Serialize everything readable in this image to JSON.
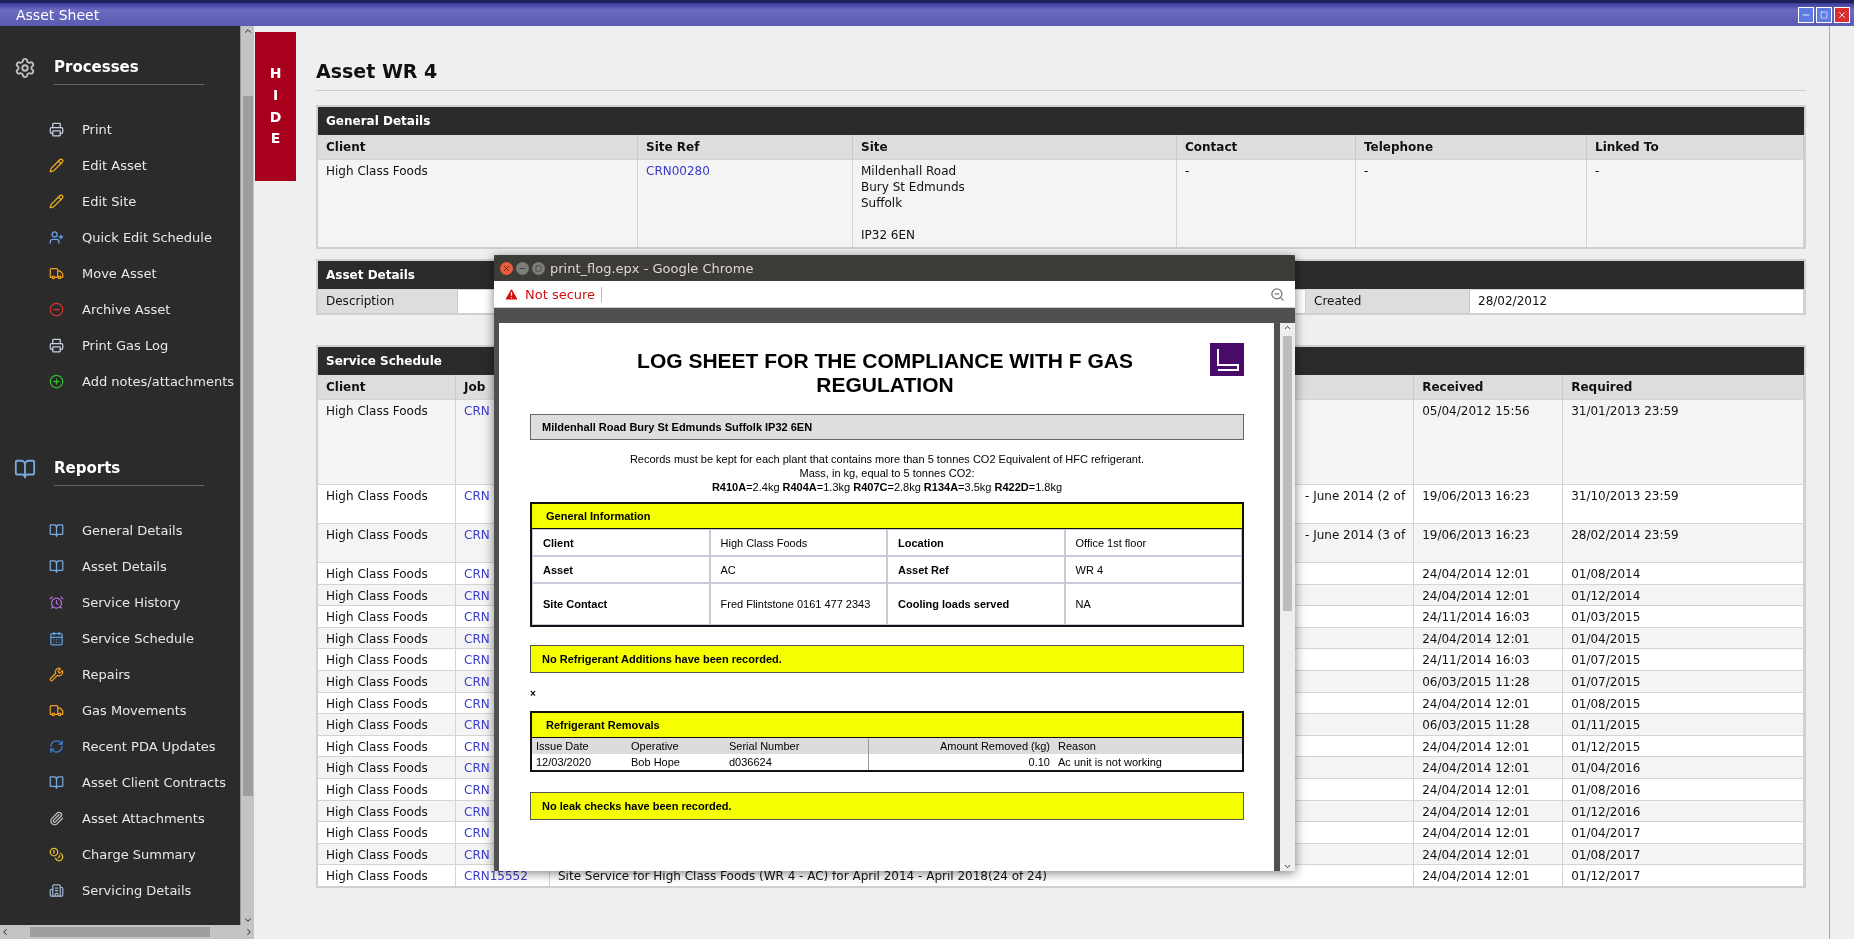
{
  "window": {
    "title": "Asset Sheet"
  },
  "sidebar": {
    "sections": [
      {
        "title": "Processes",
        "items": [
          {
            "label": "Print"
          },
          {
            "label": "Edit Asset"
          },
          {
            "label": "Edit Site"
          },
          {
            "label": "Quick Edit Schedule"
          },
          {
            "label": "Move Asset"
          },
          {
            "label": "Archive Asset"
          },
          {
            "label": "Print Gas Log"
          },
          {
            "label": "Add notes/attachments"
          }
        ]
      },
      {
        "title": "Reports",
        "items": [
          {
            "label": "General Details"
          },
          {
            "label": "Asset Details"
          },
          {
            "label": "Service History"
          },
          {
            "label": "Service Schedule"
          },
          {
            "label": "Repairs"
          },
          {
            "label": "Gas Movements"
          },
          {
            "label": "Recent PDA Updates"
          },
          {
            "label": "Asset Client Contracts"
          },
          {
            "label": "Asset Attachments"
          },
          {
            "label": "Charge Summary"
          },
          {
            "label": "Servicing Details"
          }
        ]
      }
    ]
  },
  "hide_tab": {
    "label": "HIDE"
  },
  "page": {
    "title": "Asset WR 4"
  },
  "general_details": {
    "title": "General Details",
    "columns": [
      "Client",
      "Site Ref",
      "Site",
      "Contact",
      "Telephone",
      "Linked To"
    ],
    "cells": [
      {
        "kind": "text",
        "text": "High Class Foods"
      },
      {
        "kind": "link",
        "text": "CRN00280"
      },
      {
        "kind": "address",
        "lines": [
          "Mildenhall Road",
          "Bury St Edmunds",
          "Suffolk"
        ],
        "postcode": "IP32 6EN"
      },
      {
        "kind": "text",
        "text": "-"
      },
      {
        "kind": "text",
        "text": "-"
      },
      {
        "kind": "text",
        "text": "-"
      }
    ]
  },
  "asset_details": {
    "title": "Asset Details",
    "description_label": "Description",
    "created_label": "Created",
    "created_value": "28/02/2012"
  },
  "service_schedule": {
    "title": "Service Schedule",
    "columns": {
      "client": "Client",
      "job": "Job",
      "received": "Received",
      "required": "Required"
    },
    "rows": [
      {
        "client": "High Class Foods",
        "job": "CRN",
        "received": "05/04/2012 15:56",
        "required": "31/01/2013 23:59"
      },
      {
        "client": "High Class Foods",
        "job": "CRN",
        "description_tail": "- June 2014 (2 of",
        "received": "19/06/2013 16:23",
        "required": "31/10/2013 23:59"
      },
      {
        "client": "High Class Foods",
        "job": "CRN",
        "description_tail": "- June 2014 (3 of",
        "received": "19/06/2013 16:23",
        "required": "28/02/2014 23:59"
      },
      {
        "client": "High Class Foods",
        "job": "CRN",
        "received": "24/04/2014 12:01",
        "required": "01/08/2014"
      },
      {
        "client": "High Class Foods",
        "job": "CRN",
        "received": "24/04/2014 12:01",
        "required": "01/12/2014"
      },
      {
        "client": "High Class Foods",
        "job": "CRN",
        "received": "24/11/2014 16:03",
        "required": "01/03/2015"
      },
      {
        "client": "High Class Foods",
        "job": "CRN",
        "received": "24/04/2014 12:01",
        "required": "01/04/2015"
      },
      {
        "client": "High Class Foods",
        "job": "CRN",
        "received": "24/11/2014 16:03",
        "required": "01/07/2015"
      },
      {
        "client": "High Class Foods",
        "job": "CRN",
        "received": "06/03/2015 11:28",
        "required": "01/07/2015"
      },
      {
        "client": "High Class Foods",
        "job": "CRN",
        "received": "24/04/2014 12:01",
        "required": "01/08/2015"
      },
      {
        "client": "High Class Foods",
        "job": "CRN",
        "received": "06/03/2015 11:28",
        "required": "01/11/2015"
      },
      {
        "client": "High Class Foods",
        "job": "CRN",
        "received": "24/04/2014 12:01",
        "required": "01/12/2015"
      },
      {
        "client": "High Class Foods",
        "job": "CRN",
        "received": "24/04/2014 12:01",
        "required": "01/04/2016"
      },
      {
        "client": "High Class Foods",
        "job": "CRN",
        "received": "24/04/2014 12:01",
        "required": "01/08/2016"
      },
      {
        "client": "High Class Foods",
        "job": "CRN",
        "received": "24/04/2014 12:01",
        "required": "01/12/2016"
      },
      {
        "client": "High Class Foods",
        "job": "CRN",
        "received": "24/04/2014 12:01",
        "required": "01/04/2017"
      },
      {
        "client": "High Class Foods",
        "job": "CRN",
        "received": "24/04/2014 12:01",
        "required": "01/08/2017"
      },
      {
        "client": "High Class Foods",
        "job": "CRN15552",
        "description": "Site Service for High Class Foods (WR 4 - AC) for April 2014 - April 2018(24 of 24)",
        "received": "24/04/2014 12:01",
        "required": "01/12/2017"
      }
    ]
  },
  "popup": {
    "title": "print_flog.epx - Google Chrome",
    "security": "Not secure",
    "document": {
      "title": "LOG SHEET FOR THE COMPLIANCE WITH F GAS REGULATION",
      "address": "Mildenhall Road Bury St Edmunds Suffolk IP32 6EN",
      "notes": [
        "Records must be kept for each plant that contains more than 5 tonnes CO2 Equivalent of HFC refrigerant.",
        "Mass, in kg, equal to 5 tonnes CO2:",
        "**R410A**=2.4kg **R404A**=1.3kg **R407C**=2.8kg **R134A**=3.5kg **R422D**=1.8kg"
      ],
      "general_information": {
        "title": "General Information",
        "rows": [
          [
            {
              "label": "Client",
              "value": "High Class Foods"
            },
            {
              "label": "Location",
              "value": "Office 1st floor"
            }
          ],
          [
            {
              "label": "Asset",
              "value": "AC"
            },
            {
              "label": "Asset Ref",
              "value": "WR 4"
            }
          ],
          [
            {
              "label": "Site Contact",
              "value": "Fred Flintstone 0161 477 2343"
            },
            {
              "label": "Cooling loads served",
              "value": "NA"
            }
          ]
        ]
      },
      "additions_notice": "No Refrigerant Additions have been recorded.",
      "stray_mark": "×",
      "removals": {
        "title": "Refrigerant Removals",
        "columns": [
          "Issue Date",
          "Operative",
          "Serial Number",
          "Amount Removed (kg)",
          "Reason"
        ],
        "rows": [
          [
            "12/03/2020",
            "Bob Hope",
            "d036624",
            "0.10",
            "Ac unit is not working"
          ]
        ]
      },
      "leak_notice": "No leak checks have been recorded."
    }
  }
}
